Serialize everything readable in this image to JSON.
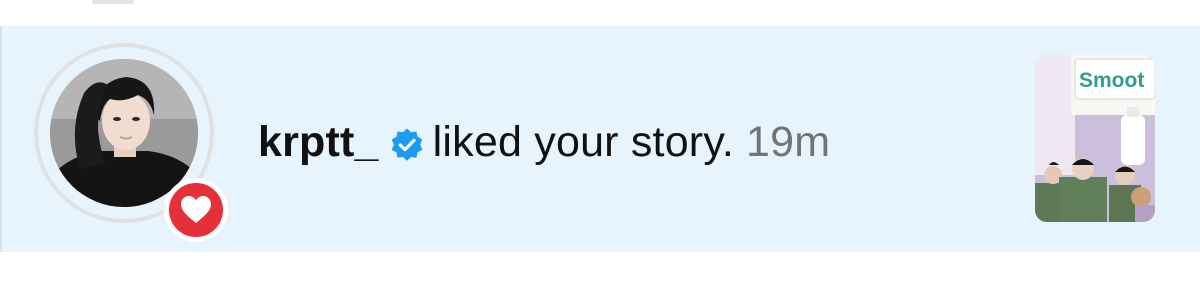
{
  "notification": {
    "username": "krptt_",
    "verified": true,
    "action_text": "liked your story.",
    "timestamp": "19m",
    "reaction": "heart-icon"
  },
  "story_preview": {
    "visible_text": "Smoot"
  },
  "colors": {
    "row_background": "#e8f4fd",
    "verified_blue": "#1d9bf0",
    "heart_red": "#e5303a",
    "timestamp_gray": "#737373",
    "text_dark": "#111111"
  }
}
